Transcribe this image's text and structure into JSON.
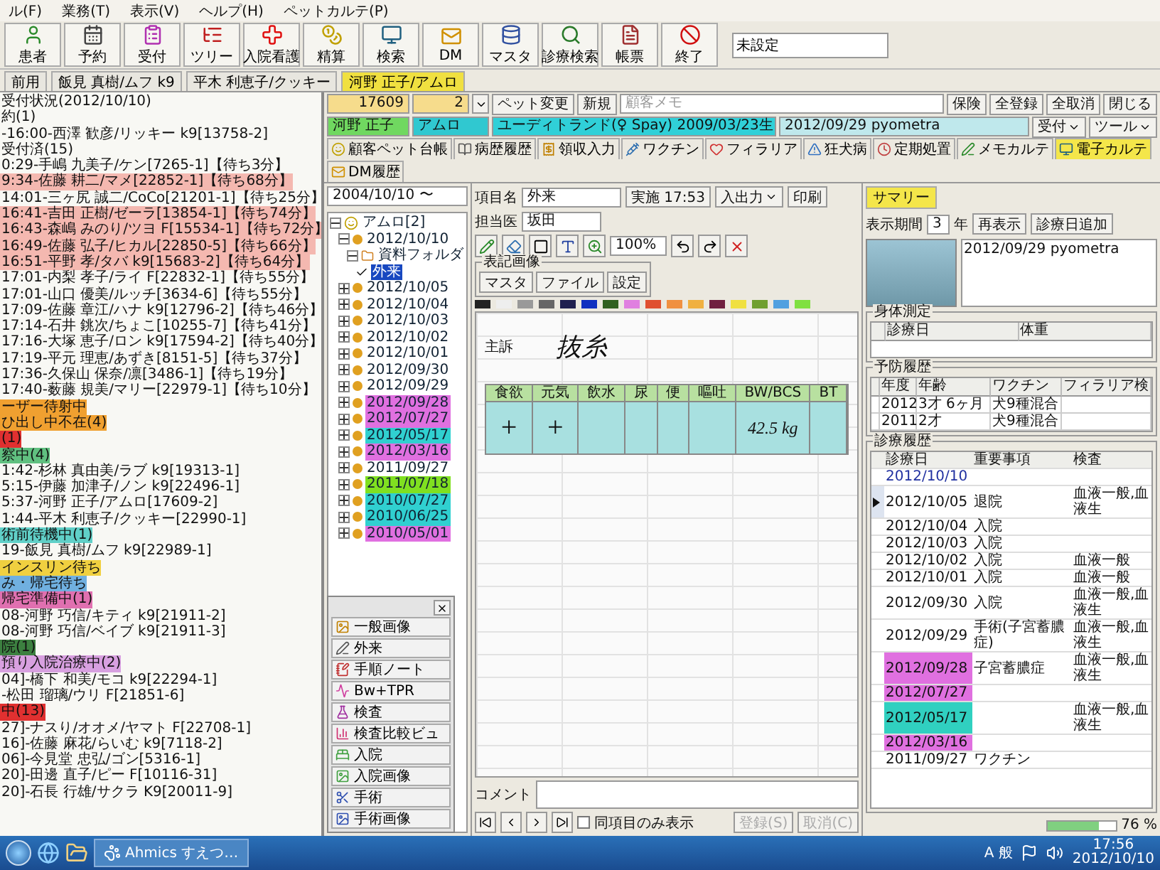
{
  "menu": [
    "ル(F)",
    "業務(T)",
    "表示(V)",
    "ヘルプ(H)",
    "ペットカルテ(P)"
  ],
  "toolbar": [
    "患者",
    "予約",
    "受付",
    "ツリー",
    "入院看護",
    "精算",
    "検索",
    "DM",
    "マスタ",
    "診療検索",
    "帳票",
    "終了"
  ],
  "toolbar_field": {
    "value": "未設定"
  },
  "patient_tabs": [
    {
      "label": "前用",
      "selected": false
    },
    {
      "label": "飯見 真樹/ムフ k9",
      "selected": false
    },
    {
      "label": "平木 利恵子/クッキー",
      "selected": false
    },
    {
      "label": "河野 正子/アムロ",
      "selected": true
    }
  ],
  "reception_list": [
    {
      "text": "受付状況(2012/10/10)"
    },
    {
      "text": "約(1)"
    },
    {
      "text": "-16:00-西澤 歓彦/リッキー k9[13758-2]"
    },
    {
      "text": "受付済(15)"
    },
    {
      "text": "0:29-手嶋 九美子/ケン[7265-1]【待ち3分】"
    },
    {
      "text": "9:34-佐藤 耕二/マメ[22852-1]【待ち68分】",
      "color": "#f4b8b0"
    },
    {
      "text": "14:01-三ヶ尻 誠二/CoCo[21201-1]【待ち25分】"
    },
    {
      "text": "16:41-吉田 正樹/ゼーラ[13854-1]【待ち74分】",
      "color": "#f4b8b0"
    },
    {
      "text": "16:43-森嶋 みのり/ツヨ F[15534-1]【待ち72分】",
      "color": "#f4b8b0"
    },
    {
      "text": "16:49-佐藤 弘子/ヒカル[22850-5]【待ち66分】",
      "color": "#f4b8b0"
    },
    {
      "text": "16:51-平野 孝/タバ k9[15683-2]【待ち64分】",
      "color": "#f4b8b0"
    },
    {
      "text": "17:01-内梨 孝子/ライ F[22832-1]【待ち55分】"
    },
    {
      "text": "17:01-山口 優美/ルッチ[3634-6]【待ち55分】"
    },
    {
      "text": "17:09-佐藤 章江/ハナ k9[12796-2]【待ち46分】"
    },
    {
      "text": "17:14-石井 銚次/ちょこ[10255-7]【待ち41分】"
    },
    {
      "text": "17:16-大塚 恵子/ロン k9[17594-2]【待ち40分】"
    },
    {
      "text": "17:19-平元 理恵/あずき[8151-5]【待ち37分】"
    },
    {
      "text": "17:36-久保山 保奈/凛[3486-1]【待ち19分】"
    },
    {
      "text": "17:40-薮藤 規美/マリー[22979-1]【待ち10分】"
    },
    {
      "text": "ーザー待射中",
      "color": "#f0a030"
    },
    {
      "text": "ひ出し中不在(4)",
      "color": "#f0a030"
    },
    {
      "text": "(1)",
      "color": "#e03030"
    },
    {
      "text": "察中(4)",
      "color": "#60c080"
    },
    {
      "text": "1:42-杉林 真由美/ラブ k9[19313-1]"
    },
    {
      "text": "5:15-伊藤 加津子/ノン k9[22496-1]"
    },
    {
      "text": "5:37-河野 正子/アムロ[17609-2]"
    },
    {
      "text": "1:44-平木 利恵子/クッキー[22990-1]"
    },
    {
      "text": "術前待機中(1)",
      "color": "#60d0c8"
    },
    {
      "text": "19-飯見 真樹/ムフ k9[22989-1]"
    },
    {
      "text": "インスリン待ち",
      "color": "#f0d040"
    },
    {
      "text": "み・帰宅待ち",
      "color": "#70b0e0"
    },
    {
      "text": "帰宅準備中(1)",
      "color": "#e070b0"
    },
    {
      "text": "08-河野 巧信/キティ k9[21911-2]"
    },
    {
      "text": "08-河野 巧信/ベイブ k9[21911-3]"
    },
    {
      "text": "院(1)",
      "color": "#3c8040"
    },
    {
      "text": "預り入院治療中(2)",
      "color": "#d8a0e0"
    },
    {
      "text": "04]-橋下 和美/モコ k9[22294-1]"
    },
    {
      "text": "-松田 瑠璃/ウリ F[21851-6]"
    },
    {
      "text": "中(13)",
      "color": "#e03030"
    },
    {
      "text": "27]-ナスり/オオメ/ヤマト F[22708-1]"
    },
    {
      "text": "16]-佐藤 麻花/らいむ k9[7118-2]"
    },
    {
      "text": "06]-今見堂 忠弘/ゴン[5316-1]"
    },
    {
      "text": "20]-田邊 直子/ピー F[10116-31]"
    },
    {
      "text": "20]-石長 行雄/サクラ K9[20011-9]"
    }
  ],
  "customer": {
    "number": "17609",
    "name": "河野 正子",
    "pet_index": "2",
    "pet_name": "アムロ",
    "breed": "ユーディトランド(♀ Spay) 2009/03/23生",
    "memo_placeholder": "顧客メモ",
    "memo": "2012/09/29 pyometra"
  },
  "header_buttons": [
    "ペット変更",
    "新規",
    "保険",
    "全登録",
    "全取消",
    "閉じる"
  ],
  "header_menus": [
    "受付",
    "ツール"
  ],
  "record_tabs": [
    {
      "label": "顧客ペット台帳",
      "selected": false
    },
    {
      "label": "病歴履歴",
      "selected": false
    },
    {
      "label": "領収入力",
      "selected": false
    },
    {
      "label": "ワクチン",
      "selected": false
    },
    {
      "label": "フィラリア",
      "selected": false
    },
    {
      "label": "狂犬病",
      "selected": false
    },
    {
      "label": "定期処置",
      "selected": false
    },
    {
      "label": "メモカルテ",
      "selected": false
    },
    {
      "label": "電子カルテ",
      "selected": true
    },
    {
      "label": "DM履歴",
      "selected": false
    }
  ],
  "tree": {
    "date_range": "2004/10/10 〜",
    "nodes": [
      {
        "label": "アムロ[2]",
        "kind": "pet",
        "expanded": true,
        "selected": false,
        "children": [
          {
            "label": "2012/10/10",
            "kind": "date",
            "expanded": true,
            "selected": false,
            "children": [
              {
                "label": "資料フォルダ",
                "kind": "folder",
                "expanded": true,
                "selected": false,
                "children": [
                  {
                    "label": "外来",
                    "kind": "page",
                    "selected": true
                  }
                ]
              }
            ]
          },
          {
            "label": "2012/10/05",
            "kind": "date",
            "expanded": false,
            "selected": false
          },
          {
            "label": "2012/10/04",
            "kind": "date",
            "expanded": false,
            "selected": false
          },
          {
            "label": "2012/10/03",
            "kind": "date",
            "expanded": false,
            "selected": false
          },
          {
            "label": "2012/10/02",
            "kind": "date",
            "expanded": false,
            "selected": false
          },
          {
            "label": "2012/10/01",
            "kind": "date",
            "expanded": false,
            "selected": false
          },
          {
            "label": "2012/09/30",
            "kind": "date",
            "expanded": false,
            "selected": false
          },
          {
            "label": "2012/09/29",
            "kind": "date",
            "expanded": false,
            "selected": false
          },
          {
            "label": "2012/09/28",
            "kind": "date",
            "expanded": false,
            "selected": false,
            "color": "#e070e0"
          },
          {
            "label": "2012/07/27",
            "kind": "date",
            "expanded": false,
            "selected": false,
            "color": "#e070e0"
          },
          {
            "label": "2012/05/17",
            "kind": "date",
            "expanded": false,
            "selected": false,
            "color": "#30d0d0"
          },
          {
            "label": "2012/03/16",
            "kind": "date",
            "expanded": false,
            "selected": false,
            "color": "#e070e0"
          },
          {
            "label": "2011/09/27",
            "kind": "date",
            "expanded": false,
            "selected": false
          },
          {
            "label": "2011/07/18",
            "kind": "date",
            "expanded": false,
            "selected": false,
            "color": "#80e020"
          },
          {
            "label": "2010/07/27",
            "kind": "date",
            "expanded": false,
            "selected": false,
            "color": "#30d0d0"
          },
          {
            "label": "2010/06/25",
            "kind": "date",
            "expanded": false,
            "selected": false,
            "color": "#30d0d0"
          },
          {
            "label": "2010/05/01",
            "kind": "date",
            "expanded": false,
            "selected": false,
            "color": "#e070e0"
          }
        ]
      }
    ]
  },
  "quick_menu": [
    "一般画像",
    "外来",
    "手順ノート",
    "Bw+TPR",
    "検査",
    "検査比較ビュ",
    "入院",
    "入院画像",
    "手術",
    "手術画像"
  ],
  "editor": {
    "item_label": "項目名",
    "item_value": "外来",
    "time_button": "実施 17:53",
    "io_menu": "入出力",
    "print_button": "印刷",
    "doctor_label": "担当医",
    "doctor": "坂田",
    "zoom": "100%",
    "image_group": "表記画像",
    "image_buttons": [
      "マスタ",
      "ファイル",
      "設定"
    ],
    "complaint_label": "主訴",
    "complaint": "抜糸",
    "vitals": [
      {
        "column": "食欲",
        "value": "+"
      },
      {
        "column": "元気",
        "value": "+"
      },
      {
        "column": "飲水"
      },
      {
        "column": "尿"
      },
      {
        "column": "便"
      },
      {
        "column": "嘔吐"
      },
      {
        "column": "BW/BCS",
        "value": "42.5 kg"
      },
      {
        "column": "BT"
      }
    ],
    "comment_label": "コメント",
    "same_item_only": {
      "label": "同項目のみ表示",
      "checked": false
    },
    "save_buttons": [
      {
        "label": "登録(S)",
        "disabled": true
      },
      {
        "label": "取消(C)",
        "disabled": true
      }
    ]
  },
  "summary": {
    "tab": "サマリー",
    "period_label": "表示期間",
    "period": "3",
    "period_unit": "年",
    "buttons": [
      "再表示",
      "診療日追加"
    ],
    "memo": "2012/09/29 pyometra",
    "body_group": "身体測定",
    "body_columns": [
      "診療日",
      "体重"
    ],
    "prevention_group": "予防履歴",
    "prevention_columns": [
      "年度",
      "年齢",
      "ワクチン",
      "フィラリア検"
    ],
    "prevention_rows": [
      [
        "2012",
        "3才 6ヶ月",
        "犬9種混合"
      ],
      [
        "2011",
        "2才",
        "犬9種混合"
      ]
    ],
    "history_group": "診療履歴",
    "history_columns": [
      "診療日",
      "重要事項",
      "検査"
    ],
    "history_rows": [
      {
        "date": "2012/10/10",
        "selected": false
      },
      {
        "date": "2012/10/05",
        "note": "退院",
        "test": "血液一般,血液生",
        "selected": true
      },
      {
        "date": "2012/10/04",
        "note": "入院",
        "selected": false
      },
      {
        "date": "2012/10/03",
        "note": "入院",
        "selected": false
      },
      {
        "date": "2012/10/02",
        "note": "入院",
        "test": "血液一般",
        "selected": false
      },
      {
        "date": "2012/10/01",
        "note": "入院",
        "test": "血液一般",
        "selected": false
      },
      {
        "date": "2012/09/30",
        "note": "入院",
        "test": "血液一般,血液生",
        "selected": false
      },
      {
        "date": "2012/09/29",
        "note": "手術(子宮蓄膿症)",
        "test": "血液一般,血液生",
        "selected": false
      },
      {
        "date": "2012/09/28",
        "note": "子宮蓄膿症",
        "test": "血液一般,血液生",
        "selected": false,
        "color": "#e070e0"
      },
      {
        "date": "2012/07/27",
        "selected": false,
        "color": "#e070e0"
      },
      {
        "date": "2012/05/17",
        "test": "血液一般,血液生",
        "selected": false,
        "color": "#30d0c0"
      },
      {
        "date": "2012/03/16",
        "selected": false,
        "color": "#e070e0"
      },
      {
        "date": "2011/09/27",
        "note": "ワクチン",
        "selected": false
      }
    ]
  },
  "status": {
    "reading": "76 %",
    "level": 0.76
  },
  "taskbar": {
    "app": "Ahmics すえつ…",
    "ime": "A 般",
    "time": "17:56",
    "date": "2012/10/10"
  }
}
